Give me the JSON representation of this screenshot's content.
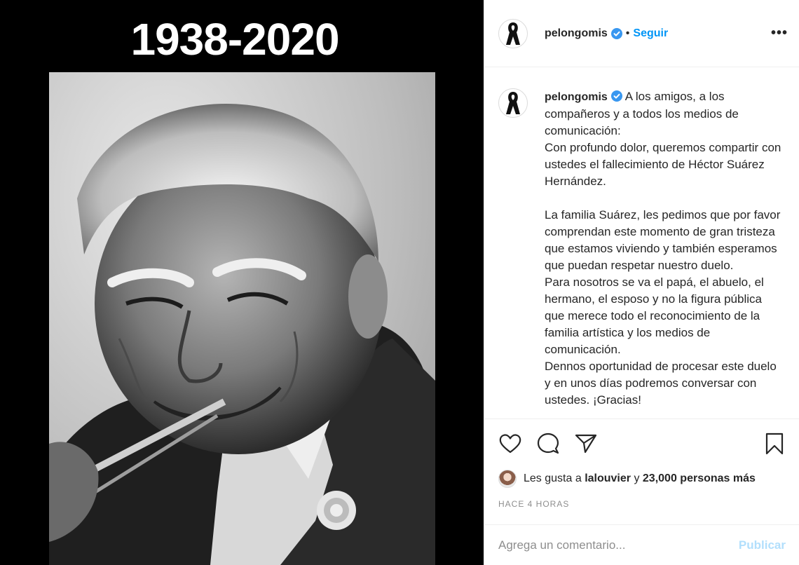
{
  "media": {
    "years": "1938-2020"
  },
  "header": {
    "username": "pelongomis",
    "separator": "•",
    "follow_label": "Seguir",
    "more_label": "•••"
  },
  "caption": {
    "username": "pelongomis",
    "paragraphs": [
      "A los amigos, a los compañeros y a todos los medios de comunicación:",
      "Con profundo dolor, queremos compartir con ustedes el fallecimiento de Héctor Suárez Hernández.",
      "",
      "La familia Suárez, les pedimos que por favor comprendan este momento de gran tristeza que estamos viviendo y también esperamos que puedan respetar nuestro duelo.",
      "Para nosotros se va el papá, el abuelo, el hermano, el esposo y no la figura pública que merece todo el reconocimiento de la familia artística y los medios de comunicación.",
      "Dennos oportunidad de procesar este duelo y en unos días podremos conversar con ustedes. ¡Gracias!"
    ]
  },
  "actions": {
    "like_icon": "heart-icon",
    "comment_icon": "comment-icon",
    "share_icon": "paper-plane-icon",
    "save_icon": "bookmark-icon"
  },
  "likes": {
    "prefix": "Les gusta a",
    "user": "lalouvier",
    "connector": "y",
    "count": "23,000 personas más"
  },
  "timestamp": "HACE 4 HORAS",
  "comment": {
    "placeholder": "Agrega un comentario...",
    "publish_label": "Publicar"
  },
  "colors": {
    "accent": "#0095f6",
    "publish_disabled": "#b2dffc",
    "verified": "#3897f0"
  }
}
